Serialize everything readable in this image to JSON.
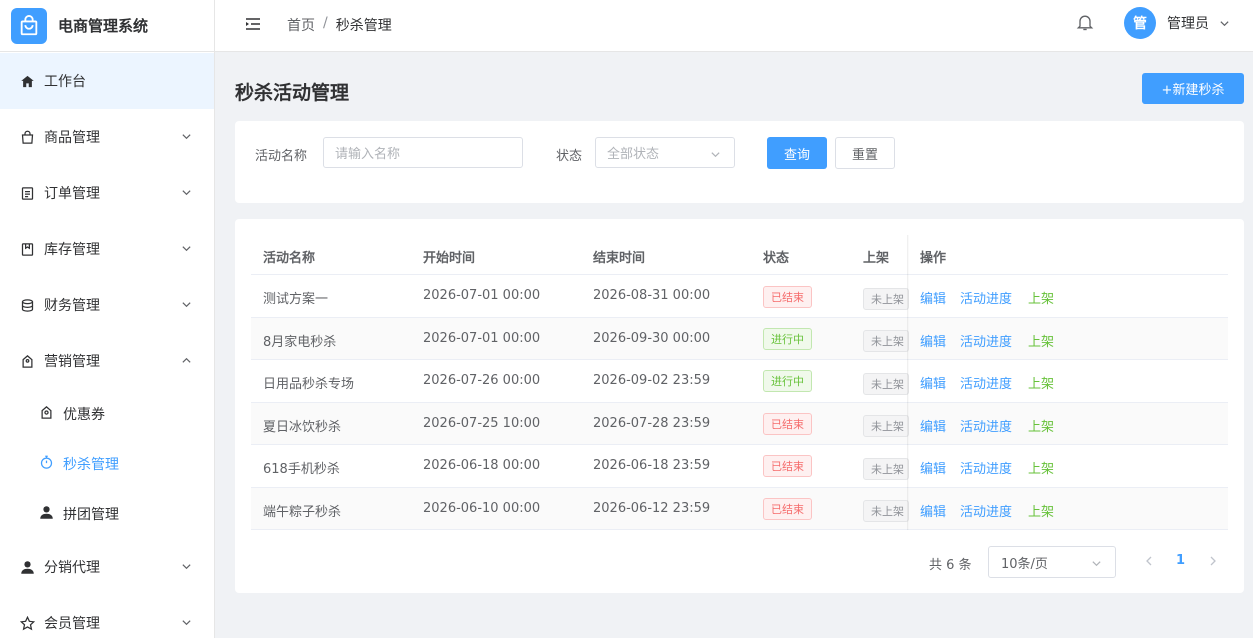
{
  "app": {
    "title": "电商管理系统"
  },
  "sidebar": {
    "items": [
      {
        "label": "工作台",
        "icon": "home-icon"
      },
      {
        "label": "商品管理",
        "icon": "bag-icon"
      },
      {
        "label": "订单管理",
        "icon": "document-icon"
      },
      {
        "label": "库存管理",
        "icon": "box-icon"
      },
      {
        "label": "财务管理",
        "icon": "coins-icon"
      },
      {
        "label": "营销管理",
        "icon": "tag-icon"
      },
      {
        "label": "分销代理",
        "icon": "user-icon"
      },
      {
        "label": "会员管理",
        "icon": "star-icon"
      }
    ],
    "sub_items": [
      {
        "label": "优惠券",
        "icon": "ticket-icon"
      },
      {
        "label": "秒杀管理",
        "icon": "stopwatch-icon"
      },
      {
        "label": "拼团管理",
        "icon": "user-icon"
      }
    ]
  },
  "header": {
    "breadcrumb": {
      "home": "首页",
      "sep": "/",
      "current": "秒杀管理"
    },
    "avatar_text": "管",
    "user_name": "管理员"
  },
  "page": {
    "title": "秒杀活动管理",
    "new_button": "+新建秒杀"
  },
  "filter": {
    "name_label": "活动名称",
    "name_placeholder": "请输入名称",
    "status_label": "状态",
    "status_value": "全部状态",
    "search_button": "查询",
    "reset_button": "重置"
  },
  "table": {
    "columns": [
      "活动名称",
      "开始时间",
      "结束时间",
      "状态",
      "上架",
      "操作"
    ],
    "rows": [
      {
        "name": "测试方案一",
        "start": "2026-07-01 00:00",
        "end": "2026-08-31 00:00",
        "status": "已结束",
        "shelf": "未上架"
      },
      {
        "name": "8月家电秒杀",
        "start": "2026-07-01 00:00",
        "end": "2026-09-30 00:00",
        "status": "进行中",
        "shelf": "未上架"
      },
      {
        "name": "日用品秒杀专场",
        "start": "2026-07-26 00:00",
        "end": "2026-09-02 23:59",
        "status": "进行中",
        "shelf": "未上架"
      },
      {
        "name": "夏日冰饮秒杀",
        "start": "2026-07-25 10:00",
        "end": "2026-07-28 23:59",
        "status": "已结束",
        "shelf": "未上架"
      },
      {
        "name": "618手机秒杀",
        "start": "2026-06-18 00:00",
        "end": "2026-06-18 23:59",
        "status": "已结束",
        "shelf": "未上架"
      },
      {
        "name": "端午粽子秒杀",
        "start": "2026-06-10 00:00",
        "end": "2026-06-12 23:59",
        "status": "已结束",
        "shelf": "未上架"
      }
    ],
    "actions": {
      "edit": "编辑",
      "progress": "活动进度",
      "publish": "上架"
    }
  },
  "pagination": {
    "total": "共 6 条",
    "page_size": "10条/页",
    "current": "1"
  },
  "colors": {
    "primary": "#409eff",
    "success": "#67c23a",
    "danger": "#f56c6c"
  }
}
